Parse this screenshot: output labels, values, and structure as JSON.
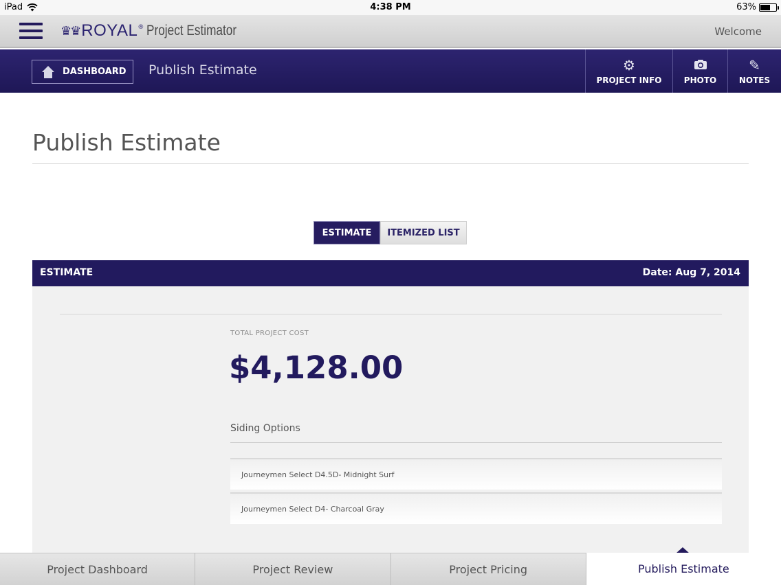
{
  "status_bar": {
    "device": "iPad",
    "time": "4:38 PM",
    "battery": "63%",
    "battery_level": 0.63
  },
  "header": {
    "brand": "ROYAL",
    "brand_mark": "®",
    "product": "Project Estimator",
    "welcome": "Welcome"
  },
  "nav": {
    "dashboard_label": "DASHBOARD",
    "title": "Publish Estimate",
    "actions": [
      {
        "label": "PROJECT INFO",
        "icon": "gear-icon"
      },
      {
        "label": "PHOTO",
        "icon": "camera-icon"
      },
      {
        "label": "NOTES",
        "icon": "pencil-icon"
      }
    ]
  },
  "page": {
    "title": "Publish Estimate",
    "segments": [
      {
        "label": "ESTIMATE",
        "active": true
      },
      {
        "label": "ITEMIZED LIST",
        "active": false
      }
    ]
  },
  "estimate": {
    "header_label": "ESTIMATE",
    "date": "Date: Aug 7, 2014",
    "total_label": "TOTAL PROJECT COST",
    "total_value": "$4,128.00",
    "section_title": "Siding Options",
    "options": [
      "Journeymen Select D4.5D- Midnight Surf",
      "Journeymen Select D4- Charcoal Gray"
    ]
  },
  "tabs": [
    {
      "label": "Project Dashboard",
      "active": false
    },
    {
      "label": "Project Review",
      "active": false
    },
    {
      "label": "Project Pricing",
      "active": false
    },
    {
      "label": "Publish Estimate",
      "active": true
    }
  ],
  "colors": {
    "brand_purple": "#221a5e",
    "nav_purple": "#2d2470",
    "panel_gray": "#f1f1f1"
  }
}
